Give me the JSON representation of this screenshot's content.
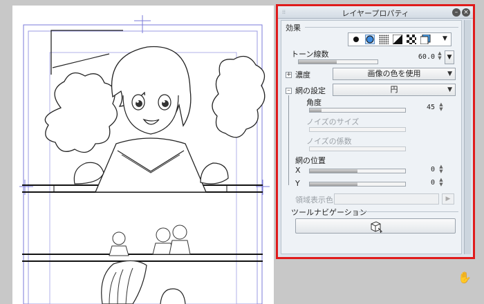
{
  "panel": {
    "title": "レイヤープロパティ",
    "effects_label": "効果",
    "tone_lines": {
      "label": "トーン線数",
      "value": "60.0"
    },
    "density": {
      "label": "濃度",
      "selected": "画像の色を使用"
    },
    "dot_settings": {
      "label": "網の設定",
      "selected": "円"
    },
    "angle": {
      "label": "角度",
      "value": "45"
    },
    "noise_size": {
      "label": "ノイズのサイズ"
    },
    "noise_factor": {
      "label": "ノイズの係数"
    },
    "dot_position": {
      "label": "網の位置",
      "x_label": "X",
      "x_value": "0",
      "y_label": "Y",
      "y_value": "0"
    },
    "area_color": {
      "label": "領域表示色"
    },
    "tool_nav": {
      "label": "ツールナビゲーション"
    }
  },
  "values": {
    "tone_lines_fraction": 0.48,
    "angle_fraction": 0.12,
    "x_fraction": 0.5,
    "y_fraction": 0.5
  },
  "colors": {
    "highlight_border": "#e01a1a",
    "panel_bg": "#eef2f6"
  }
}
